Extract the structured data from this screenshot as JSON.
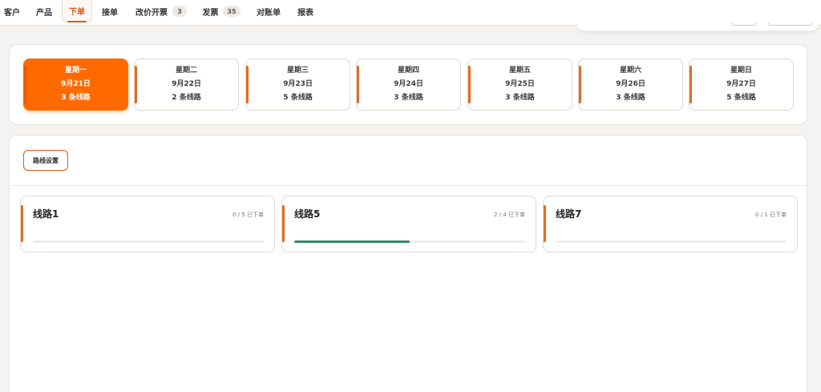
{
  "nav": {
    "items": [
      {
        "label": "客户"
      },
      {
        "label": "产品"
      },
      {
        "label": "下单",
        "active": true
      },
      {
        "label": "接单"
      },
      {
        "label": "改价开票",
        "badge": "3"
      },
      {
        "label": "发票",
        "badge": "35"
      },
      {
        "label": "对账单"
      },
      {
        "label": "报表"
      }
    ]
  },
  "days": [
    {
      "weekday": "星期一",
      "date": "9月21日",
      "routes": "3 条线路",
      "selected": true
    },
    {
      "weekday": "星期二",
      "date": "9月22日",
      "routes": "2 条线路"
    },
    {
      "weekday": "星期三",
      "date": "9月23日",
      "routes": "5 条线路"
    },
    {
      "weekday": "星期四",
      "date": "9月24日",
      "routes": "3 条线路"
    },
    {
      "weekday": "星期五",
      "date": "9月25日",
      "routes": "3 条线路"
    },
    {
      "weekday": "星期六",
      "date": "9月26日",
      "routes": "3 条线路"
    },
    {
      "weekday": "星期日",
      "date": "9月27日",
      "routes": "5 条线路"
    }
  ],
  "routes_panel": {
    "setting_button": "路线设置",
    "routes": [
      {
        "name": "线路1",
        "count": "0 / 5 已下单",
        "progress": 0
      },
      {
        "name": "线路5",
        "count": "2 / 4 已下单",
        "progress": 0.5
      },
      {
        "name": "线路7",
        "count": "0 / 1 已下单",
        "progress": 0
      }
    ]
  },
  "colors": {
    "accent": "#ff6a00",
    "accent_dark": "#e2560e",
    "progress": "#2e8b62"
  }
}
